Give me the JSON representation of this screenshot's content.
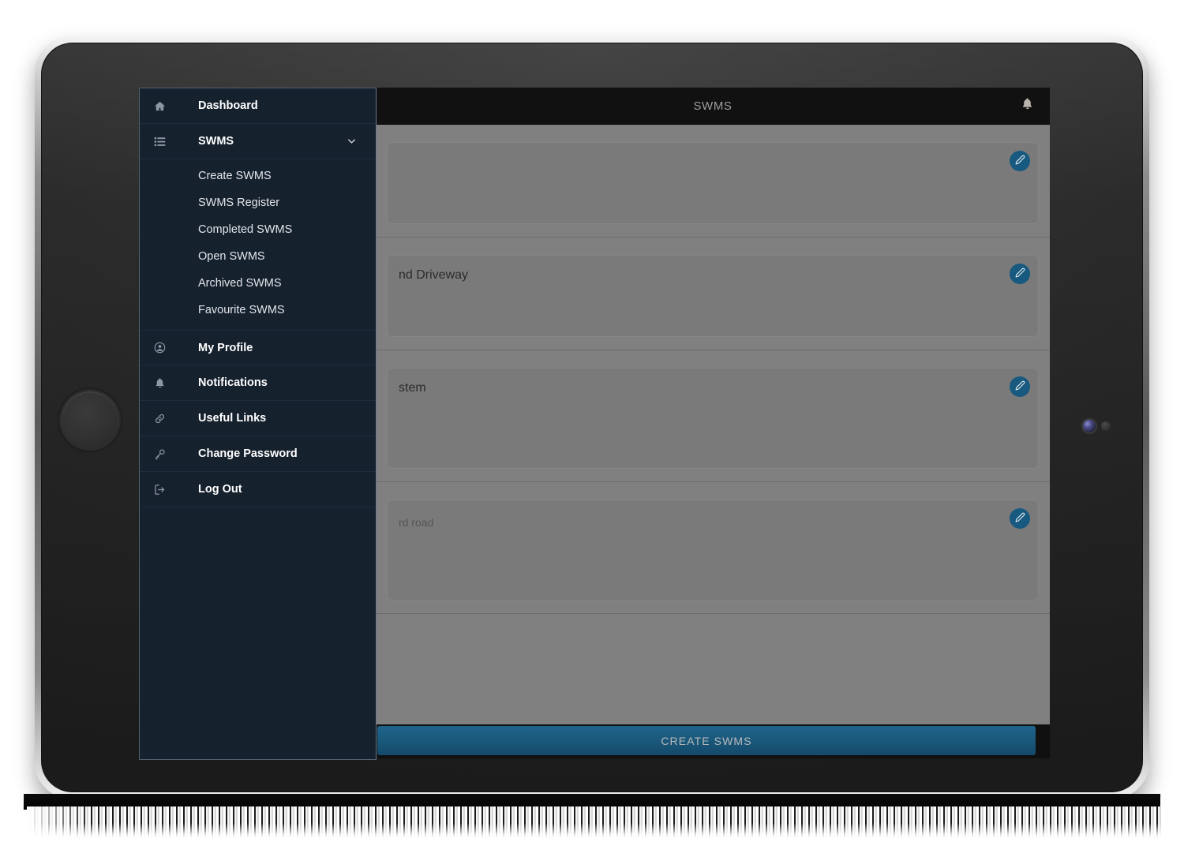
{
  "device": {
    "type": "tablet",
    "home_button": "home-button",
    "camera": "front-camera",
    "sensor": "ambient-light-sensor"
  },
  "app": {
    "header": {
      "title": "SWMS",
      "notification_icon": "bell-icon"
    },
    "footer": {
      "create_label": "CREATE SWMS"
    },
    "list": [
      {
        "title": "",
        "subtitle": "",
        "edit_icon": "edit-pencil-icon"
      },
      {
        "title": "nd Driveway",
        "subtitle": "",
        "edit_icon": "edit-pencil-icon"
      },
      {
        "title": "stem",
        "subtitle": "",
        "edit_icon": "edit-pencil-icon"
      },
      {
        "title": "",
        "subtitle": "rd road",
        "edit_icon": "edit-pencil-icon"
      }
    ]
  },
  "drawer": {
    "items": [
      {
        "label": "Dashboard",
        "icon": "home-icon",
        "expandable": false
      },
      {
        "label": "SWMS",
        "icon": "list-icon",
        "expandable": true,
        "chevron": "chevron-down-icon"
      },
      {
        "label": "My Profile",
        "icon": "user-circle-icon",
        "expandable": false
      },
      {
        "label": "Notifications",
        "icon": "bell-icon",
        "expandable": false
      },
      {
        "label": "Useful Links",
        "icon": "link-icon",
        "expandable": false
      },
      {
        "label": "Change Password",
        "icon": "key-icon",
        "expandable": false
      },
      {
        "label": "Log Out",
        "icon": "logout-icon",
        "expandable": false
      }
    ],
    "swms_submenu": [
      {
        "label": "Create SWMS"
      },
      {
        "label": "SWMS Register"
      },
      {
        "label": "Completed SWMS"
      },
      {
        "label": "Open SWMS"
      },
      {
        "label": "Archived SWMS"
      },
      {
        "label": "Favourite SWMS"
      }
    ]
  },
  "colors": {
    "drawer_bg": "#16212e",
    "header_bg": "#111111",
    "overlay": "#808080",
    "accent_blue": "#17597f",
    "create_button": "#195779"
  }
}
